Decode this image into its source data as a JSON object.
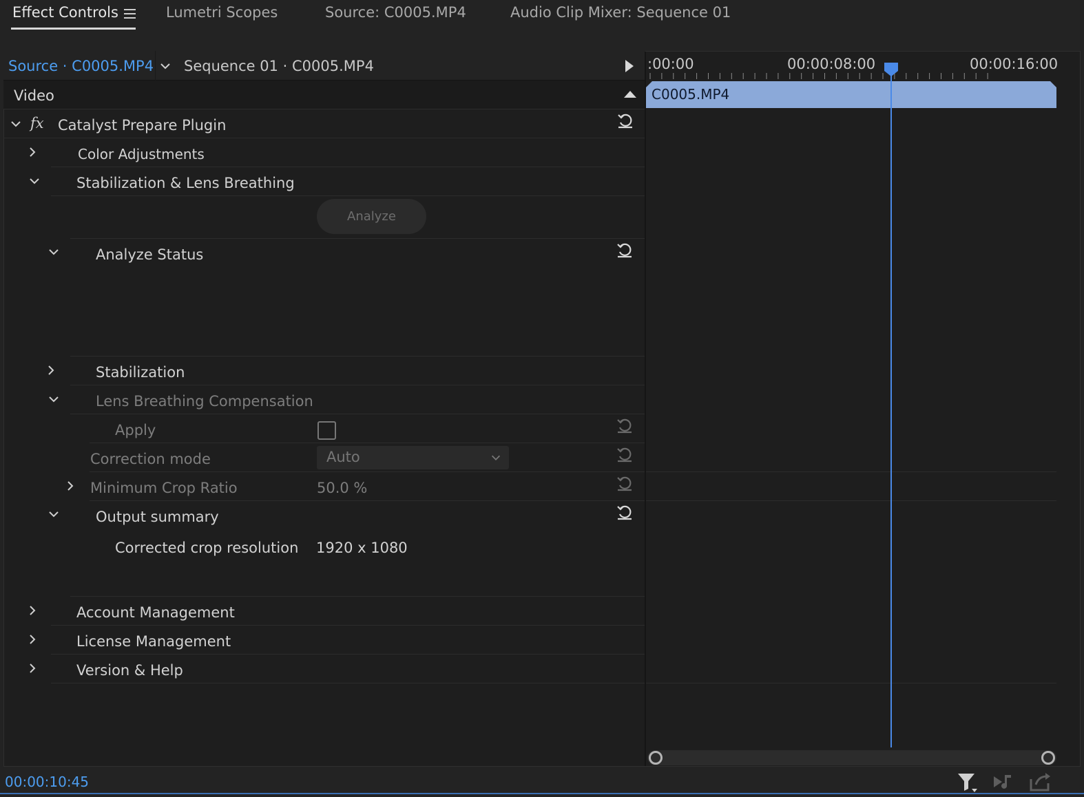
{
  "tabs": [
    {
      "label": "Effect Controls",
      "active": true
    },
    {
      "label": "Lumetri Scopes",
      "active": false
    },
    {
      "label": "Source: C0005.MP4",
      "active": false
    },
    {
      "label": "Audio Clip Mixer: Sequence 01",
      "active": false
    }
  ],
  "source_bar": {
    "source": "Source · C0005.MP4",
    "sequence": "Sequence 01 · C0005.MP4"
  },
  "section": "Video",
  "effect": {
    "fx_symbol": "fx",
    "name": "Catalyst Prepare Plugin",
    "groups": {
      "color": "Color Adjustments",
      "stab_lens": "Stabilization & Lens Breathing",
      "analyze_button": "Analyze",
      "analyze_status": "Analyze Status",
      "stabilization": "Stabilization",
      "lens_breathing": "Lens Breathing Compensation",
      "apply": "Apply",
      "correction_mode": "Correction mode",
      "correction_mode_value": "Auto",
      "min_crop_ratio": "Minimum Crop Ratio",
      "min_crop_ratio_value": "50.0 %",
      "output_summary": "Output summary",
      "corrected_crop_resolution": "Corrected crop resolution",
      "corrected_crop_resolution_value": "1920 x 1080",
      "account": "Account Management",
      "license": "License Management",
      "version": "Version & Help"
    }
  },
  "timeline": {
    "timecodes": [
      ":00:00",
      "00:00:08:00",
      "00:00:16:00"
    ],
    "clip_label": "C0005.MP4"
  },
  "footer": {
    "timecode": "00:00:10:45"
  },
  "colors": {
    "accent_blue": "#4d9df0",
    "clip_blue": "#8ba9d9",
    "playhead": "#4a8ae8"
  }
}
